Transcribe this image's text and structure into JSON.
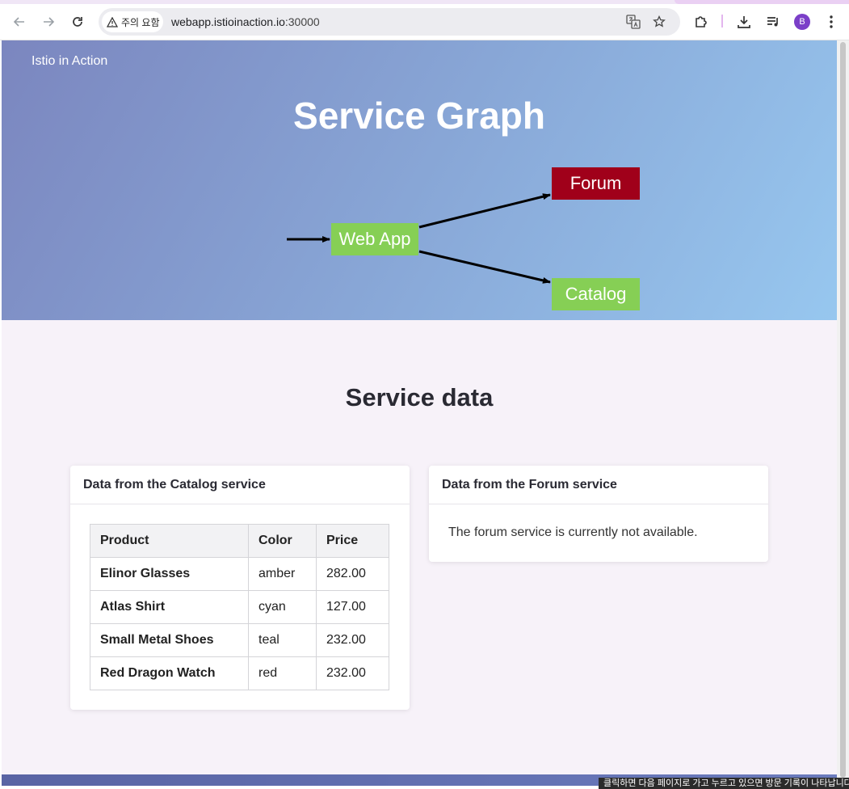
{
  "browser": {
    "security_chip": "주의 요함",
    "url_host": "webapp.istioinaction.io",
    "url_port": ":30000",
    "profile_initial": "B",
    "status_tooltip": "클릭하면 다음 페이지로 가고 누르고 있으면 방문 기록이 나타납니다."
  },
  "hero": {
    "brand": "Istio in Action",
    "title": "Service Graph",
    "graph": {
      "nodes": [
        {
          "id": "webapp",
          "label": "Web App",
          "color": "#86cf55"
        },
        {
          "id": "forum",
          "label": "Forum",
          "color": "#a0001a"
        },
        {
          "id": "catalog",
          "label": "Catalog",
          "color": "#86cf55"
        }
      ],
      "edges": [
        {
          "from": "client",
          "to": "webapp"
        },
        {
          "from": "webapp",
          "to": "forum"
        },
        {
          "from": "webapp",
          "to": "catalog"
        }
      ]
    }
  },
  "service_data": {
    "title": "Service data",
    "catalog_card": {
      "header": "Data from the Catalog service",
      "columns": [
        "Product",
        "Color",
        "Price"
      ],
      "rows": [
        [
          "Elinor Glasses",
          "amber",
          "282.00"
        ],
        [
          "Atlas Shirt",
          "cyan",
          "127.00"
        ],
        [
          "Small Metal Shoes",
          "teal",
          "232.00"
        ],
        [
          "Red Dragon Watch",
          "red",
          "232.00"
        ]
      ]
    },
    "forum_card": {
      "header": "Data from the Forum service",
      "message": "The forum service is currently not available."
    }
  }
}
